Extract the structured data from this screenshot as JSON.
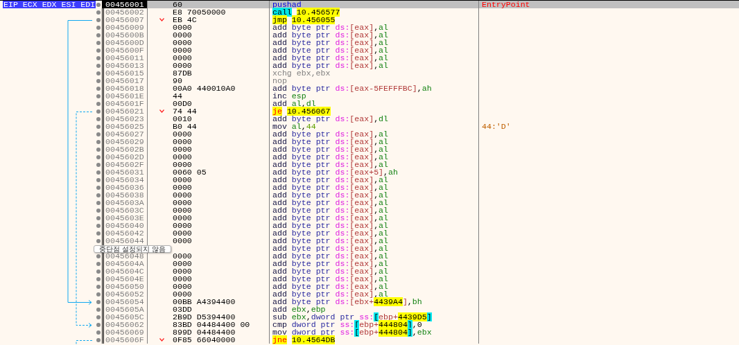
{
  "registers_label": "EIP ECX EDX ESI EDI",
  "tooltip": "중단점 설정되지 않음",
  "rows": [
    {
      "address": "00456001",
      "bytes": "60",
      "selected": true,
      "jump": false,
      "tokens": [
        {
          "kind": "pushad",
          "text": "pushad"
        }
      ],
      "comment": {
        "kind": "label",
        "text": "EntryPoint"
      }
    },
    {
      "address": "00456002",
      "bytes": "E8 70050000",
      "selected": false,
      "jump": false,
      "tokens": [
        {
          "kind": "call",
          "text": "call"
        },
        {
          "kind": "target",
          "text": "10.456577"
        }
      ]
    },
    {
      "address": "00456007",
      "bytes": "EB 4C",
      "selected": false,
      "jump": true,
      "tokens": [
        {
          "kind": "jmp",
          "text": "jmp"
        },
        {
          "kind": "target",
          "text": "10.456055"
        }
      ]
    },
    {
      "address": "00456009",
      "bytes": "0000",
      "selected": false,
      "jump": false,
      "tokens": [
        {
          "kind": "op",
          "text": "add "
        },
        {
          "kind": "ptr",
          "text": "byte ptr "
        },
        {
          "kind": "seg",
          "text": "ds:"
        },
        {
          "kind": "mem",
          "text": "[eax]"
        },
        {
          "kind": "punct",
          "text": ","
        },
        {
          "kind": "reg",
          "text": "al"
        }
      ]
    },
    {
      "address": "0045600B",
      "bytes": "0000",
      "selected": false,
      "jump": false,
      "tokens": [
        {
          "kind": "op",
          "text": "add "
        },
        {
          "kind": "ptr",
          "text": "byte ptr "
        },
        {
          "kind": "seg",
          "text": "ds:"
        },
        {
          "kind": "mem",
          "text": "[eax]"
        },
        {
          "kind": "punct",
          "text": ","
        },
        {
          "kind": "reg",
          "text": "al"
        }
      ]
    },
    {
      "address": "0045600D",
      "bytes": "0000",
      "selected": false,
      "jump": false,
      "tokens": [
        {
          "kind": "op",
          "text": "add "
        },
        {
          "kind": "ptr",
          "text": "byte ptr "
        },
        {
          "kind": "seg",
          "text": "ds:"
        },
        {
          "kind": "mem",
          "text": "[eax]"
        },
        {
          "kind": "punct",
          "text": ","
        },
        {
          "kind": "reg",
          "text": "al"
        }
      ]
    },
    {
      "address": "0045600F",
      "bytes": "0000",
      "selected": false,
      "jump": false,
      "tokens": [
        {
          "kind": "op",
          "text": "add "
        },
        {
          "kind": "ptr",
          "text": "byte ptr "
        },
        {
          "kind": "seg",
          "text": "ds:"
        },
        {
          "kind": "mem",
          "text": "[eax]"
        },
        {
          "kind": "punct",
          "text": ","
        },
        {
          "kind": "reg",
          "text": "al"
        }
      ]
    },
    {
      "address": "00456011",
      "bytes": "0000",
      "selected": false,
      "jump": false,
      "tokens": [
        {
          "kind": "op",
          "text": "add "
        },
        {
          "kind": "ptr",
          "text": "byte ptr "
        },
        {
          "kind": "seg",
          "text": "ds:"
        },
        {
          "kind": "mem",
          "text": "[eax]"
        },
        {
          "kind": "punct",
          "text": ","
        },
        {
          "kind": "reg",
          "text": "al"
        }
      ]
    },
    {
      "address": "00456013",
      "bytes": "0000",
      "selected": false,
      "jump": false,
      "tokens": [
        {
          "kind": "op",
          "text": "add "
        },
        {
          "kind": "ptr",
          "text": "byte ptr "
        },
        {
          "kind": "seg",
          "text": "ds:"
        },
        {
          "kind": "mem",
          "text": "[eax]"
        },
        {
          "kind": "punct",
          "text": ","
        },
        {
          "kind": "reg",
          "text": "al"
        }
      ]
    },
    {
      "address": "00456015",
      "bytes": "87DB",
      "selected": false,
      "jump": false,
      "tokens": [
        {
          "kind": "gray",
          "text": "xchg ebx,ebx"
        }
      ]
    },
    {
      "address": "00456017",
      "bytes": "90",
      "selected": false,
      "jump": false,
      "tokens": [
        {
          "kind": "gray",
          "text": "nop"
        }
      ]
    },
    {
      "address": "00456018",
      "bytes": "00A0 440010A0",
      "selected": false,
      "jump": false,
      "tokens": [
        {
          "kind": "op",
          "text": "add "
        },
        {
          "kind": "ptr",
          "text": "byte ptr "
        },
        {
          "kind": "seg",
          "text": "ds:"
        },
        {
          "kind": "mem",
          "text": "[eax-5FEFFFBC]"
        },
        {
          "kind": "punct",
          "text": ","
        },
        {
          "kind": "reg",
          "text": "ah"
        }
      ]
    },
    {
      "address": "0045601E",
      "bytes": "44",
      "selected": false,
      "jump": false,
      "tokens": [
        {
          "kind": "op",
          "text": "inc "
        },
        {
          "kind": "reg",
          "text": "esp"
        }
      ]
    },
    {
      "address": "0045601F",
      "bytes": "00D0",
      "selected": false,
      "jump": false,
      "tokens": [
        {
          "kind": "op",
          "text": "add "
        },
        {
          "kind": "reg",
          "text": "al"
        },
        {
          "kind": "punct",
          "text": ","
        },
        {
          "kind": "reg",
          "text": "dl"
        }
      ]
    },
    {
      "address": "00456021",
      "bytes": "74 44",
      "selected": false,
      "jump": true,
      "tokens": [
        {
          "kind": "jcc",
          "text": "je"
        },
        {
          "kind": "target",
          "text": "10.456067"
        }
      ]
    },
    {
      "address": "00456023",
      "bytes": "0010",
      "selected": false,
      "jump": false,
      "tokens": [
        {
          "kind": "op",
          "text": "add "
        },
        {
          "kind": "ptr",
          "text": "byte ptr "
        },
        {
          "kind": "seg",
          "text": "ds:"
        },
        {
          "kind": "mem",
          "text": "[eax]"
        },
        {
          "kind": "punct",
          "text": ","
        },
        {
          "kind": "reg",
          "text": "dl"
        }
      ]
    },
    {
      "address": "00456025",
      "bytes": "B0 44",
      "selected": false,
      "jump": false,
      "tokens": [
        {
          "kind": "op",
          "text": "mov "
        },
        {
          "kind": "reg",
          "text": "al"
        },
        {
          "kind": "punct",
          "text": ","
        },
        {
          "kind": "num",
          "text": "44"
        }
      ],
      "comment": {
        "kind": "note",
        "text": "44:'D'"
      }
    },
    {
      "address": "00456027",
      "bytes": "0000",
      "selected": false,
      "jump": false,
      "tokens": [
        {
          "kind": "op",
          "text": "add "
        },
        {
          "kind": "ptr",
          "text": "byte ptr "
        },
        {
          "kind": "seg",
          "text": "ds:"
        },
        {
          "kind": "mem",
          "text": "[eax]"
        },
        {
          "kind": "punct",
          "text": ","
        },
        {
          "kind": "reg",
          "text": "al"
        }
      ]
    },
    {
      "address": "00456029",
      "bytes": "0000",
      "selected": false,
      "jump": false,
      "tokens": [
        {
          "kind": "op",
          "text": "add "
        },
        {
          "kind": "ptr",
          "text": "byte ptr "
        },
        {
          "kind": "seg",
          "text": "ds:"
        },
        {
          "kind": "mem",
          "text": "[eax]"
        },
        {
          "kind": "punct",
          "text": ","
        },
        {
          "kind": "reg",
          "text": "al"
        }
      ]
    },
    {
      "address": "0045602B",
      "bytes": "0000",
      "selected": false,
      "jump": false,
      "tokens": [
        {
          "kind": "op",
          "text": "add "
        },
        {
          "kind": "ptr",
          "text": "byte ptr "
        },
        {
          "kind": "seg",
          "text": "ds:"
        },
        {
          "kind": "mem",
          "text": "[eax]"
        },
        {
          "kind": "punct",
          "text": ","
        },
        {
          "kind": "reg",
          "text": "al"
        }
      ]
    },
    {
      "address": "0045602D",
      "bytes": "0000",
      "selected": false,
      "jump": false,
      "tokens": [
        {
          "kind": "op",
          "text": "add "
        },
        {
          "kind": "ptr",
          "text": "byte ptr "
        },
        {
          "kind": "seg",
          "text": "ds:"
        },
        {
          "kind": "mem",
          "text": "[eax]"
        },
        {
          "kind": "punct",
          "text": ","
        },
        {
          "kind": "reg",
          "text": "al"
        }
      ]
    },
    {
      "address": "0045602F",
      "bytes": "0000",
      "selected": false,
      "jump": false,
      "tokens": [
        {
          "kind": "op",
          "text": "add "
        },
        {
          "kind": "ptr",
          "text": "byte ptr "
        },
        {
          "kind": "seg",
          "text": "ds:"
        },
        {
          "kind": "mem",
          "text": "[eax]"
        },
        {
          "kind": "punct",
          "text": ","
        },
        {
          "kind": "reg",
          "text": "al"
        }
      ]
    },
    {
      "address": "00456031",
      "bytes": "0060 05",
      "selected": false,
      "jump": false,
      "tokens": [
        {
          "kind": "op",
          "text": "add "
        },
        {
          "kind": "ptr",
          "text": "byte ptr "
        },
        {
          "kind": "seg",
          "text": "ds:"
        },
        {
          "kind": "mem",
          "text": "[eax+5]"
        },
        {
          "kind": "punct",
          "text": ","
        },
        {
          "kind": "reg",
          "text": "ah"
        }
      ]
    },
    {
      "address": "00456034",
      "bytes": "0000",
      "selected": false,
      "jump": false,
      "tokens": [
        {
          "kind": "op",
          "text": "add "
        },
        {
          "kind": "ptr",
          "text": "byte ptr "
        },
        {
          "kind": "seg",
          "text": "ds:"
        },
        {
          "kind": "mem",
          "text": "[eax]"
        },
        {
          "kind": "punct",
          "text": ","
        },
        {
          "kind": "reg",
          "text": "al"
        }
      ]
    },
    {
      "address": "00456036",
      "bytes": "0000",
      "selected": false,
      "jump": false,
      "tokens": [
        {
          "kind": "op",
          "text": "add "
        },
        {
          "kind": "ptr",
          "text": "byte ptr "
        },
        {
          "kind": "seg",
          "text": "ds:"
        },
        {
          "kind": "mem",
          "text": "[eax]"
        },
        {
          "kind": "punct",
          "text": ","
        },
        {
          "kind": "reg",
          "text": "al"
        }
      ]
    },
    {
      "address": "00456038",
      "bytes": "0000",
      "selected": false,
      "jump": false,
      "tokens": [
        {
          "kind": "op",
          "text": "add "
        },
        {
          "kind": "ptr",
          "text": "byte ptr "
        },
        {
          "kind": "seg",
          "text": "ds:"
        },
        {
          "kind": "mem",
          "text": "[eax]"
        },
        {
          "kind": "punct",
          "text": ","
        },
        {
          "kind": "reg",
          "text": "al"
        }
      ]
    },
    {
      "address": "0045603A",
      "bytes": "0000",
      "selected": false,
      "jump": false,
      "tokens": [
        {
          "kind": "op",
          "text": "add "
        },
        {
          "kind": "ptr",
          "text": "byte ptr "
        },
        {
          "kind": "seg",
          "text": "ds:"
        },
        {
          "kind": "mem",
          "text": "[eax]"
        },
        {
          "kind": "punct",
          "text": ","
        },
        {
          "kind": "reg",
          "text": "al"
        }
      ]
    },
    {
      "address": "0045603C",
      "bytes": "0000",
      "selected": false,
      "jump": false,
      "tokens": [
        {
          "kind": "op",
          "text": "add "
        },
        {
          "kind": "ptr",
          "text": "byte ptr "
        },
        {
          "kind": "seg",
          "text": "ds:"
        },
        {
          "kind": "mem",
          "text": "[eax]"
        },
        {
          "kind": "punct",
          "text": ","
        },
        {
          "kind": "reg",
          "text": "al"
        }
      ]
    },
    {
      "address": "0045603E",
      "bytes": "0000",
      "selected": false,
      "jump": false,
      "tokens": [
        {
          "kind": "op",
          "text": "add "
        },
        {
          "kind": "ptr",
          "text": "byte ptr "
        },
        {
          "kind": "seg",
          "text": "ds:"
        },
        {
          "kind": "mem",
          "text": "[eax]"
        },
        {
          "kind": "punct",
          "text": ","
        },
        {
          "kind": "reg",
          "text": "al"
        }
      ]
    },
    {
      "address": "00456040",
      "bytes": "0000",
      "selected": false,
      "jump": false,
      "tokens": [
        {
          "kind": "op",
          "text": "add "
        },
        {
          "kind": "ptr",
          "text": "byte ptr "
        },
        {
          "kind": "seg",
          "text": "ds:"
        },
        {
          "kind": "mem",
          "text": "[eax]"
        },
        {
          "kind": "punct",
          "text": ","
        },
        {
          "kind": "reg",
          "text": "al"
        }
      ]
    },
    {
      "address": "00456042",
      "bytes": "0000",
      "selected": false,
      "jump": false,
      "tokens": [
        {
          "kind": "op",
          "text": "add "
        },
        {
          "kind": "ptr",
          "text": "byte ptr "
        },
        {
          "kind": "seg",
          "text": "ds:"
        },
        {
          "kind": "mem",
          "text": "[eax]"
        },
        {
          "kind": "punct",
          "text": ","
        },
        {
          "kind": "reg",
          "text": "al"
        }
      ]
    },
    {
      "address": "00456044",
      "bytes": "0000",
      "selected": false,
      "jump": false,
      "tokens": [
        {
          "kind": "op",
          "text": "add "
        },
        {
          "kind": "ptr",
          "text": "byte ptr "
        },
        {
          "kind": "seg",
          "text": "ds:"
        },
        {
          "kind": "mem",
          "text": "[eax]"
        },
        {
          "kind": "punct",
          "text": ","
        },
        {
          "kind": "reg",
          "text": "al"
        }
      ]
    },
    {
      "selected": false,
      "jump": false,
      "tokens": [
        {
          "kind": "op",
          "text": "add "
        },
        {
          "kind": "ptr",
          "text": "byte ptr "
        },
        {
          "kind": "seg",
          "text": "ds:"
        },
        {
          "kind": "mem",
          "text": "[eax]"
        },
        {
          "kind": "punct",
          "text": ","
        },
        {
          "kind": "reg",
          "text": "al"
        }
      ]
    },
    {
      "address": "00456048",
      "bytes": "0000",
      "selected": false,
      "jump": false,
      "tokens": [
        {
          "kind": "op",
          "text": "add "
        },
        {
          "kind": "ptr",
          "text": "byte ptr "
        },
        {
          "kind": "seg",
          "text": "ds:"
        },
        {
          "kind": "mem",
          "text": "[eax]"
        },
        {
          "kind": "punct",
          "text": ","
        },
        {
          "kind": "reg",
          "text": "al"
        }
      ]
    },
    {
      "address": "0045604A",
      "bytes": "0000",
      "selected": false,
      "jump": false,
      "tokens": [
        {
          "kind": "op",
          "text": "add "
        },
        {
          "kind": "ptr",
          "text": "byte ptr "
        },
        {
          "kind": "seg",
          "text": "ds:"
        },
        {
          "kind": "mem",
          "text": "[eax]"
        },
        {
          "kind": "punct",
          "text": ","
        },
        {
          "kind": "reg",
          "text": "al"
        }
      ]
    },
    {
      "address": "0045604C",
      "bytes": "0000",
      "selected": false,
      "jump": false,
      "tokens": [
        {
          "kind": "op",
          "text": "add "
        },
        {
          "kind": "ptr",
          "text": "byte ptr "
        },
        {
          "kind": "seg",
          "text": "ds:"
        },
        {
          "kind": "mem",
          "text": "[eax]"
        },
        {
          "kind": "punct",
          "text": ","
        },
        {
          "kind": "reg",
          "text": "al"
        }
      ]
    },
    {
      "address": "0045604E",
      "bytes": "0000",
      "selected": false,
      "jump": false,
      "tokens": [
        {
          "kind": "op",
          "text": "add "
        },
        {
          "kind": "ptr",
          "text": "byte ptr "
        },
        {
          "kind": "seg",
          "text": "ds:"
        },
        {
          "kind": "mem",
          "text": "[eax]"
        },
        {
          "kind": "punct",
          "text": ","
        },
        {
          "kind": "reg",
          "text": "al"
        }
      ]
    },
    {
      "address": "00456050",
      "bytes": "0000",
      "selected": false,
      "jump": false,
      "tokens": [
        {
          "kind": "op",
          "text": "add "
        },
        {
          "kind": "ptr",
          "text": "byte ptr "
        },
        {
          "kind": "seg",
          "text": "ds:"
        },
        {
          "kind": "mem",
          "text": "[eax]"
        },
        {
          "kind": "punct",
          "text": ","
        },
        {
          "kind": "reg",
          "text": "al"
        }
      ]
    },
    {
      "address": "00456052",
      "bytes": "0000",
      "selected": false,
      "jump": false,
      "tokens": [
        {
          "kind": "op",
          "text": "add "
        },
        {
          "kind": "ptr",
          "text": "byte ptr "
        },
        {
          "kind": "seg",
          "text": "ds:"
        },
        {
          "kind": "mem",
          "text": "[eax]"
        },
        {
          "kind": "punct",
          "text": ","
        },
        {
          "kind": "reg",
          "text": "al"
        }
      ]
    },
    {
      "address": "00456054",
      "bytes": "00BB A4394400",
      "selected": false,
      "jump": false,
      "tokens": [
        {
          "kind": "op",
          "text": "add "
        },
        {
          "kind": "ptr",
          "text": "byte ptr "
        },
        {
          "kind": "seg",
          "text": "ds:"
        },
        {
          "kind": "mem",
          "text": "[ebx+"
        },
        {
          "kind": "numhl",
          "text": "4439A4"
        },
        {
          "kind": "mem",
          "text": "]"
        },
        {
          "kind": "punct",
          "text": ","
        },
        {
          "kind": "reg",
          "text": "bh"
        }
      ]
    },
    {
      "address": "0045605A",
      "bytes": "03DD",
      "selected": false,
      "jump": false,
      "tokens": [
        {
          "kind": "op",
          "text": "add "
        },
        {
          "kind": "reg",
          "text": "ebx"
        },
        {
          "kind": "punct",
          "text": ","
        },
        {
          "kind": "reg",
          "text": "ebp"
        }
      ]
    },
    {
      "address": "0045605C",
      "bytes": "2B9D D5394400",
      "selected": false,
      "jump": false,
      "tokens": [
        {
          "kind": "op",
          "text": "sub "
        },
        {
          "kind": "reg",
          "text": "ebx"
        },
        {
          "kind": "punct",
          "text": ","
        },
        {
          "kind": "ptr",
          "text": "dword ptr "
        },
        {
          "kind": "seg",
          "text": "ss:"
        },
        {
          "kind": "memhl",
          "text": "["
        },
        {
          "kind": "mem",
          "text": "ebp+"
        },
        {
          "kind": "numhl",
          "text": "4439D5"
        },
        {
          "kind": "memhl",
          "text": "]"
        }
      ]
    },
    {
      "address": "00456062",
      "bytes": "83BD 04484400 00",
      "selected": false,
      "jump": false,
      "tokens": [
        {
          "kind": "op",
          "text": "cmp "
        },
        {
          "kind": "ptr",
          "text": "dword ptr "
        },
        {
          "kind": "seg",
          "text": "ss:"
        },
        {
          "kind": "memhl",
          "text": "["
        },
        {
          "kind": "mem",
          "text": "ebp+"
        },
        {
          "kind": "numhl",
          "text": "444804"
        },
        {
          "kind": "memhl",
          "text": "]"
        },
        {
          "kind": "punct",
          "text": ",0"
        }
      ]
    },
    {
      "address": "00456069",
      "bytes": "899D 04484400",
      "selected": false,
      "jump": false,
      "tokens": [
        {
          "kind": "op",
          "text": "mov "
        },
        {
          "kind": "ptr",
          "text": "dword ptr "
        },
        {
          "kind": "seg",
          "text": "ss:"
        },
        {
          "kind": "memhl",
          "text": "["
        },
        {
          "kind": "mem",
          "text": "ebp+"
        },
        {
          "kind": "numhl",
          "text": "444804"
        },
        {
          "kind": "memhl",
          "text": "]"
        },
        {
          "kind": "punct",
          "text": ","
        },
        {
          "kind": "reg",
          "text": "ebx"
        }
      ]
    },
    {
      "address": "0045606F",
      "bytes": "0F85 66040000",
      "selected": false,
      "jump": true,
      "tokens": [
        {
          "kind": "jcc",
          "text": "jne"
        },
        {
          "kind": "target",
          "text": "10.4564DB"
        }
      ]
    }
  ]
}
